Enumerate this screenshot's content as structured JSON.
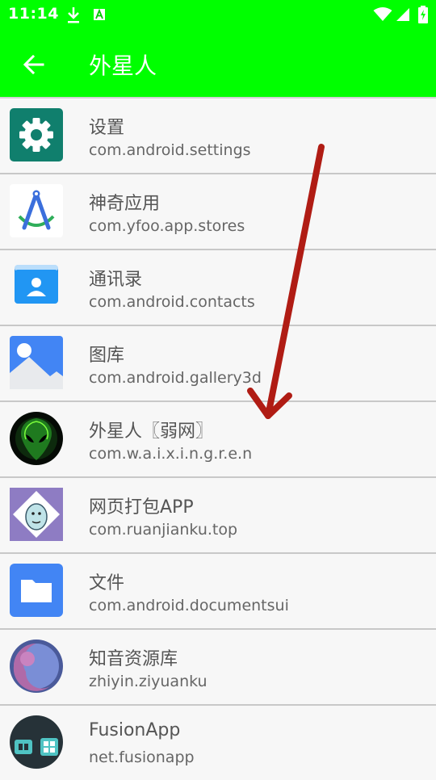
{
  "status_bar": {
    "time": "11:14"
  },
  "app_bar": {
    "title": "外星人"
  },
  "apps": [
    {
      "name": "设置",
      "package": "com.android.settings",
      "icon": "settings-icon"
    },
    {
      "name": "神奇应用",
      "package": "com.yfoo.app.stores",
      "icon": "stores-icon"
    },
    {
      "name": "通讯录",
      "package": "com.android.contacts",
      "icon": "contacts-icon"
    },
    {
      "name": "图库",
      "package": "com.android.gallery3d",
      "icon": "gallery-icon"
    },
    {
      "name": "外星人〖弱网〗",
      "package": "com.w.a.i.x.i.n.g.r.e.n",
      "icon": "alien-icon"
    },
    {
      "name": "网页打包APP",
      "package": "com.ruanjianku.top",
      "icon": "webpack-icon"
    },
    {
      "name": "文件",
      "package": "com.android.documentsui",
      "icon": "folder-icon"
    },
    {
      "name": "知音资源库",
      "package": "zhiyin.ziyuanku",
      "icon": "planet-icon"
    },
    {
      "name": "FusionApp",
      "package": "net.fusionapp",
      "icon": "fusionapp-icon"
    }
  ],
  "colors": {
    "accent": "#00ff00",
    "annotation_arrow": "#b01c14"
  }
}
